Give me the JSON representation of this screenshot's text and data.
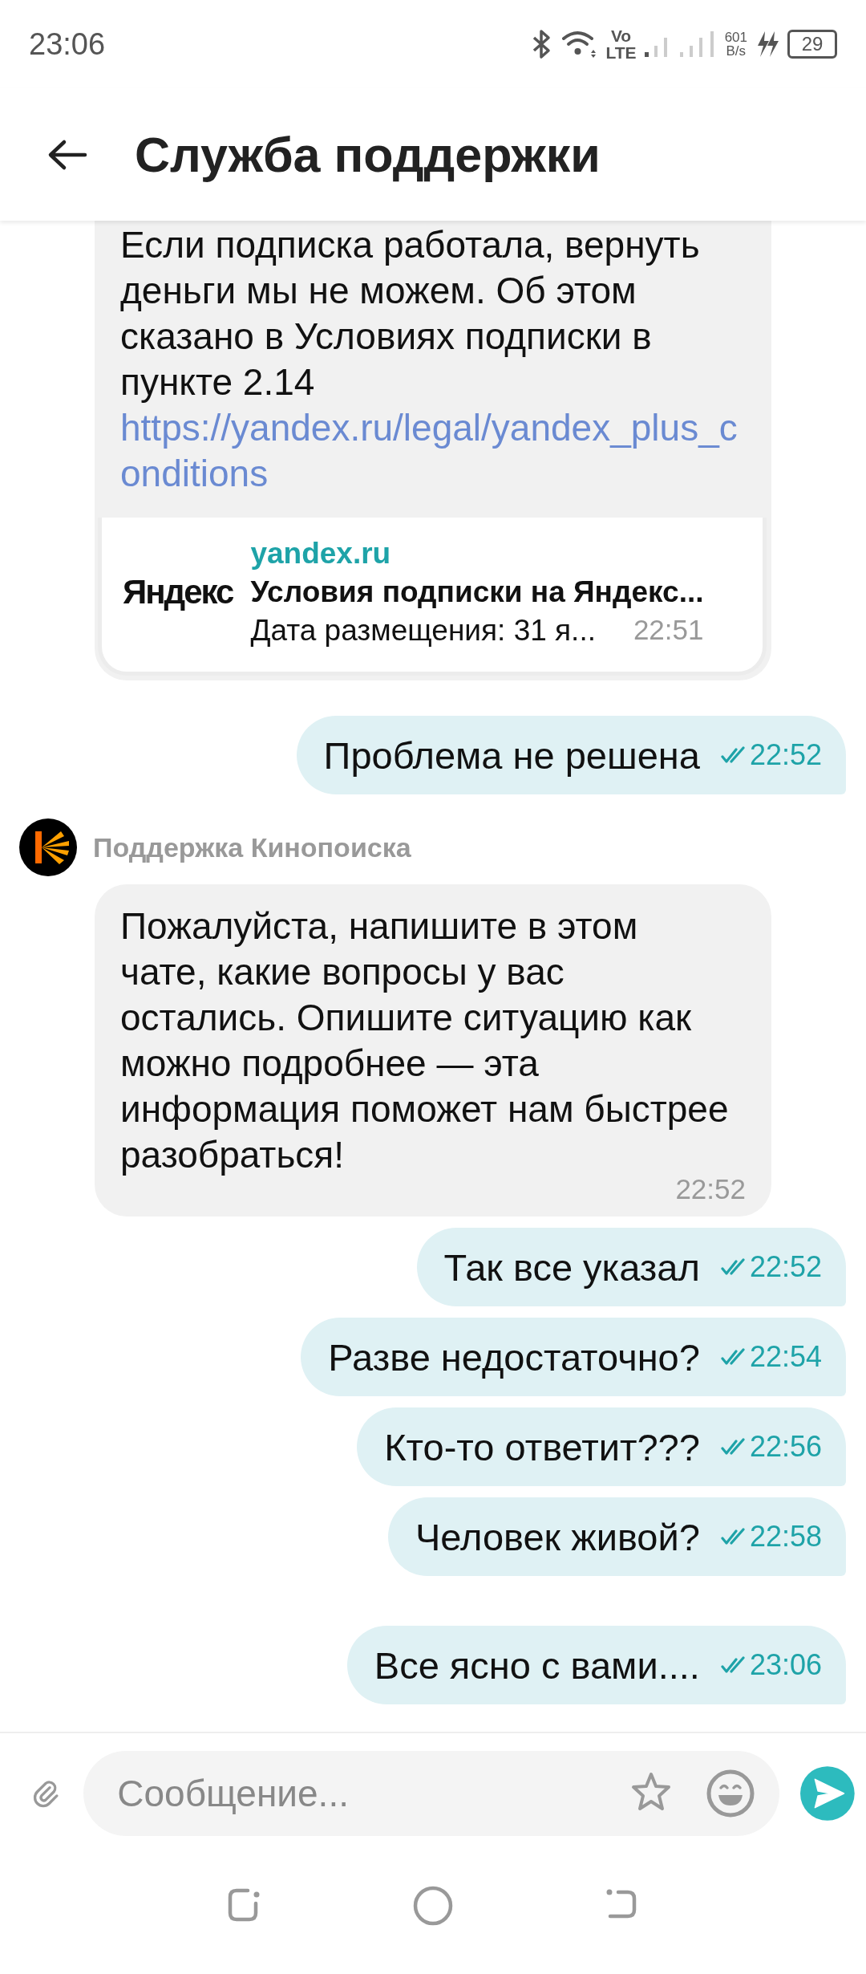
{
  "status_bar": {
    "time": "23:06",
    "network_top": "Vo",
    "network_bottom": "LTE",
    "speed_value": "601",
    "speed_unit": "B/s",
    "battery": "29"
  },
  "header": {
    "title": "Служба поддержки"
  },
  "messages": [
    {
      "kind": "incoming",
      "text": "Если подписка работала, вернуть деньги мы не можем. Об этом сказано в Условиях подписки в пункте 2.14",
      "link": "https://yandex.ru/legal/yandex_plus_conditions",
      "preview": {
        "logo": "Яндекс",
        "site": "yandex.ru",
        "title": "Условия подписки на Яндекс...",
        "description": "Дата размещения: 31 я..."
      },
      "time": "22:51"
    },
    {
      "kind": "outgoing",
      "text": "Проблема не решена",
      "time": "22:52",
      "read": true
    },
    {
      "kind": "incoming",
      "sender": "Поддержка Кинопоиска",
      "text": "Пожалуйста, напишите в этом чате, какие вопросы у вас остались. Опишите ситуацию как можно подробнее — эта информация поможет нам быстрее разобраться!",
      "time": "22:52"
    },
    {
      "kind": "outgoing",
      "text": "Так все указал",
      "time": "22:52",
      "read": true
    },
    {
      "kind": "outgoing",
      "text": "Разве недостаточно?",
      "time": "22:54",
      "read": true
    },
    {
      "kind": "outgoing",
      "text": "Кто-то ответит???",
      "time": "22:56",
      "read": true
    },
    {
      "kind": "outgoing",
      "text": "Человек живой?",
      "time": "22:58",
      "read": true
    },
    {
      "kind": "outgoing",
      "text": "Все ясно с вами....",
      "time": "23:06",
      "read": true
    }
  ],
  "composer": {
    "placeholder": "Сообщение..."
  }
}
